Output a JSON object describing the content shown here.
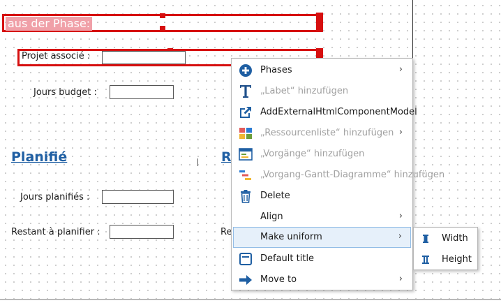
{
  "form": {
    "phase_label": "aus der Phase:",
    "projet_label": "Projet associé :",
    "jours_budget_label": "Jours budget :",
    "planifie_title": "Planifié",
    "r_title": "R",
    "jours_planifies_label": "Jours planifiés :",
    "restant_label": "Restant à planifier :",
    "re_label": "Re"
  },
  "menu": {
    "items": [
      {
        "label": "Phases",
        "icon": "plus-circle-icon",
        "enabled": true,
        "submenu": true
      },
      {
        "label": "„Labet“ hinzufügen",
        "icon": "text-t-icon",
        "enabled": false,
        "submenu": false
      },
      {
        "label": "AddExternalHtmlComponentModel",
        "icon": "external-link-icon",
        "enabled": true,
        "submenu": false
      },
      {
        "label": "„Ressourcenliste“ hinzufügen",
        "icon": "resource-grid-icon",
        "enabled": false,
        "submenu": true
      },
      {
        "label": "„Vorgänge“ hinzufügen",
        "icon": "window-list-icon",
        "enabled": false,
        "submenu": false
      },
      {
        "label": "„Vorgang-Gantt-Diagramme“ hinzufügen",
        "icon": "gantt-icon",
        "enabled": false,
        "submenu": false
      },
      {
        "label": "Delete",
        "icon": "trash-icon",
        "enabled": true,
        "submenu": false
      },
      {
        "label": "Align",
        "icon": "",
        "enabled": true,
        "submenu": true
      },
      {
        "label": "Make uniform",
        "icon": "",
        "enabled": true,
        "submenu": true,
        "highlighted": true
      },
      {
        "label": "Default title",
        "icon": "title-frame-icon",
        "enabled": true,
        "submenu": false
      },
      {
        "label": "Move to",
        "icon": "arrow-right-icon",
        "enabled": true,
        "submenu": true
      }
    ],
    "arrow_glyph": "›"
  },
  "submenu": {
    "width_label": "Width",
    "height_label": "Height"
  },
  "colors": {
    "selection": "#d60f0f",
    "title_blue": "#1f5fa3",
    "icon_blue": "#1f5fa3",
    "highlight_bg": "#e6f0fa"
  }
}
